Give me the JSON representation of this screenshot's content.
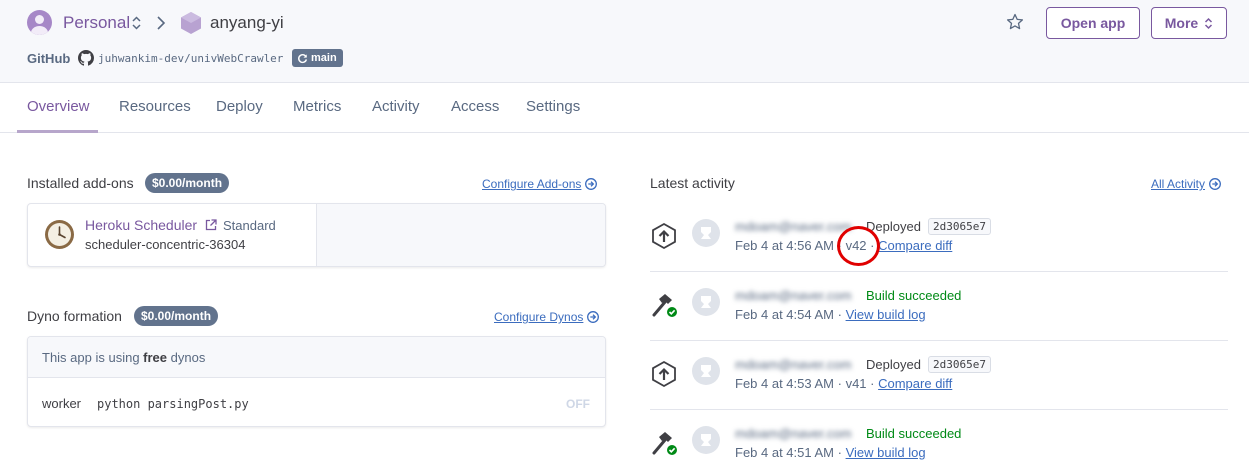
{
  "header": {
    "team_name": "Personal",
    "app_name": "anyang-yi",
    "github_label": "GitHub",
    "repo": "juhwankim-dev/univWebCrawler",
    "branch": "main",
    "open_app_label": "Open app",
    "more_label": "More"
  },
  "tabs": [
    {
      "label": "Overview"
    },
    {
      "label": "Resources"
    },
    {
      "label": "Deploy"
    },
    {
      "label": "Metrics"
    },
    {
      "label": "Activity"
    },
    {
      "label": "Access"
    },
    {
      "label": "Settings"
    }
  ],
  "addons": {
    "title": "Installed add-ons",
    "price": "$0.00/month",
    "configure_label": "Configure Add-ons",
    "item": {
      "name": "Heroku Scheduler",
      "plan": "Standard",
      "instance": "scheduler-concentric-36304",
      "icon": "clock-icon"
    }
  },
  "dynos": {
    "title": "Dyno formation",
    "price": "$0.00/month",
    "configure_label": "Configure Dynos",
    "note_prefix": "This app is using ",
    "note_bold": "free",
    "note_suffix": " dynos",
    "type": "worker",
    "command": "python parsingPost.py",
    "status": "OFF"
  },
  "activity": {
    "title": "Latest activity",
    "all_label": "All Activity",
    "items": [
      {
        "kind": "deploy",
        "user": "mdoam@naver.com",
        "status": "Deployed",
        "commit": "2d3065e7",
        "time": "Feb 4 at 4:56 AM",
        "version": "v42",
        "link": "Compare diff"
      },
      {
        "kind": "build",
        "user": "mdoam@naver.com",
        "status": "Build succeeded",
        "time": "Feb 4 at 4:54 AM",
        "link": "View build log"
      },
      {
        "kind": "deploy",
        "user": "mdoam@naver.com",
        "status": "Deployed",
        "commit": "2d3065e7",
        "time": "Feb 4 at 4:53 AM",
        "version": "v41",
        "link": "Compare diff"
      },
      {
        "kind": "build",
        "user": "mdoam@naver.com",
        "status": "Build succeeded",
        "time": "Feb 4 at 4:51 AM",
        "link": "View build log"
      }
    ]
  },
  "separators": {
    "dot": " · "
  },
  "colors": {
    "accent": "#79589f",
    "link": "#3b6cbe",
    "success": "#008a16",
    "badge": "#62738d",
    "annotation": "#e00000"
  }
}
